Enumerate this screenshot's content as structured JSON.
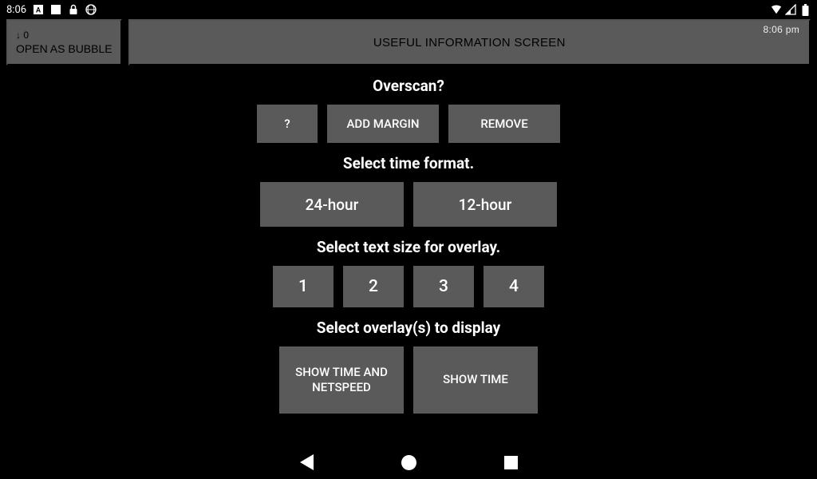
{
  "status": {
    "time": "8:06",
    "overlay_clock": "8:06 pm"
  },
  "header": {
    "bubble_top": "↓ 0",
    "bubble_label": "OPEN AS BUBBLE",
    "info_label": "USEFUL INFORMATION SCREEN"
  },
  "overscan": {
    "heading": "Overscan?",
    "q": "?",
    "add_margin": "ADD MARGIN",
    "remove": "REMOVE"
  },
  "time_format": {
    "heading": "Select time format.",
    "opt24": "24-hour",
    "opt12": "12-hour"
  },
  "text_size": {
    "heading": "Select text size for overlay.",
    "s1": "1",
    "s2": "2",
    "s3": "3",
    "s4": "4"
  },
  "overlays": {
    "heading": "Select overlay(s) to display",
    "time_netspeed": "SHOW TIME AND NETSPEED",
    "time": "SHOW TIME"
  }
}
